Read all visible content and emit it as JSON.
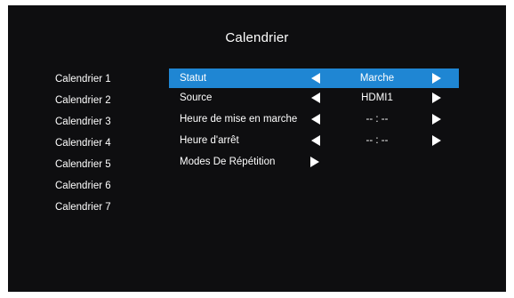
{
  "title": "Calendrier",
  "schedules": [
    "Calendrier 1",
    "Calendrier 2",
    "Calendrier 3",
    "Calendrier 4",
    "Calendrier 5",
    "Calendrier 6",
    "Calendrier 7"
  ],
  "settings": {
    "status": {
      "label": "Statut",
      "value": "Marche"
    },
    "source": {
      "label": "Source",
      "value": "HDMI1"
    },
    "on_time": {
      "label": "Heure de mise en marche",
      "value": "-- : --"
    },
    "off_time": {
      "label": "Heure d'arrêt",
      "value": "-- : --"
    },
    "repeat_modes": {
      "label": "Modes De Répétition"
    }
  },
  "colors": {
    "background": "#0e0e10",
    "highlight": "#1f86d3",
    "text": "#ffffff"
  },
  "icons": {
    "decrease": "left-triangle",
    "increase": "right-triangle"
  }
}
